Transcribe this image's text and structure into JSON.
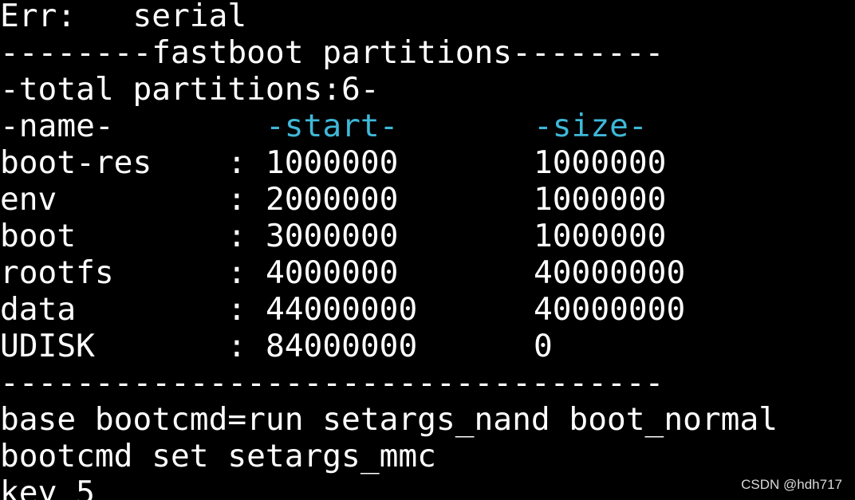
{
  "terminal": {
    "fg_color": "#ffffff",
    "bg_color": "#000000",
    "header_color": "#3fb8d8",
    "err_line": "Err:   serial",
    "title_line": "--------fastboot partitions--------",
    "total_line": "-total partitions:6-",
    "table": {
      "headers": {
        "name": "-name-",
        "start": "-start-",
        "size": "-size-"
      },
      "separator": ":",
      "rows": [
        {
          "name": "boot-res",
          "start": "1000000",
          "size": "1000000"
        },
        {
          "name": "env",
          "start": "2000000",
          "size": "1000000"
        },
        {
          "name": "boot",
          "start": "3000000",
          "size": "1000000"
        },
        {
          "name": "rootfs",
          "start": "4000000",
          "size": "40000000"
        },
        {
          "name": "data",
          "start": "44000000",
          "size": "40000000"
        },
        {
          "name": "UDISK",
          "start": "84000000",
          "size": "0"
        }
      ]
    },
    "rule_line": "-----------------------------------",
    "bootcmd_line": "base bootcmd=run setargs_nand boot_normal",
    "set_line": "bootcmd set setargs_mmc",
    "key_line": "key 5"
  },
  "watermark": "CSDN @hdh717"
}
